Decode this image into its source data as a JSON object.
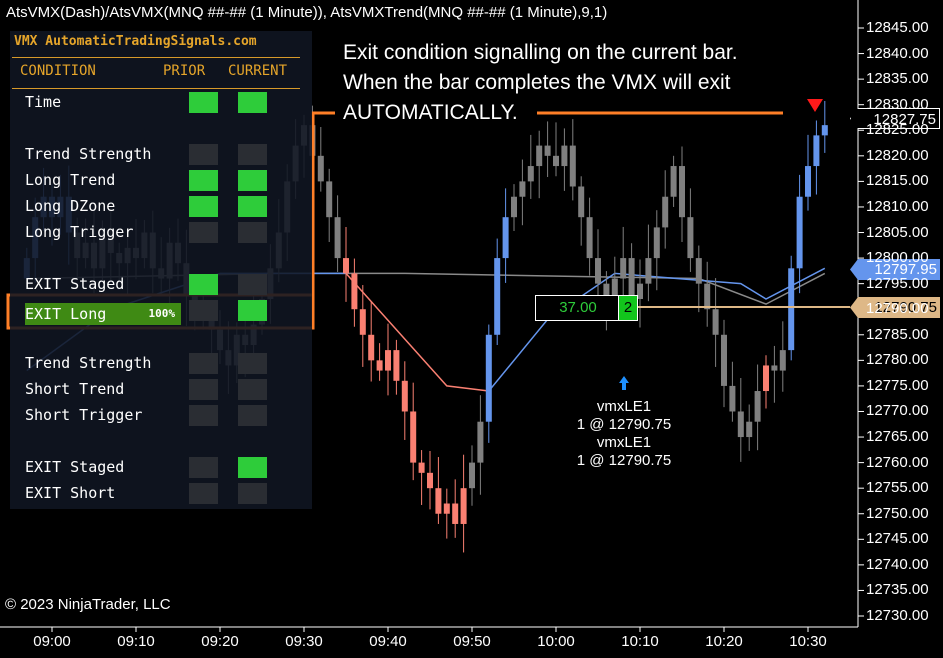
{
  "header": {
    "title": "AtsVMX(Dash)/AtsVMX(MNQ ##-## (1 Minute)), AtsVMXTrend(MNQ ##-## (1 Minute),9,1)"
  },
  "copyright": "© 2023 NinjaTrader, LLC",
  "panel": {
    "title": "VMX AutomaticTradingSignals.com",
    "headers": {
      "condition": "CONDITION",
      "prior": "PRIOR",
      "current": "CURRENT"
    },
    "rows": [
      {
        "label": "Time",
        "prior": "on",
        "current": "on"
      },
      {
        "label": "Trend Strength",
        "prior": "off",
        "current": "off"
      },
      {
        "label": "Long Trend",
        "prior": "on",
        "current": "on"
      },
      {
        "label": "Long DZone",
        "prior": "on",
        "current": "on"
      },
      {
        "label": "Long Trigger",
        "prior": "off",
        "current": "off"
      },
      {
        "label": "EXIT Staged",
        "prior": "on",
        "current": "off"
      },
      {
        "label": "EXIT Long",
        "prior": "off",
        "current": "on",
        "highlight_pct": "100%"
      },
      {
        "label": "Trend Strength",
        "prior": "off",
        "current": "off"
      },
      {
        "label": "Short Trend",
        "prior": "off",
        "current": "off"
      },
      {
        "label": "Short Trigger",
        "prior": "off",
        "current": "off"
      },
      {
        "label": "EXIT Staged",
        "prior": "off",
        "current": "on"
      },
      {
        "label": "EXIT Short",
        "prior": "off",
        "current": "off"
      }
    ]
  },
  "annotation": {
    "line1": "Exit condition signalling on the current bar.",
    "line2": "When the bar completes the VMX will exit",
    "line3": "AUTOMATICALLY."
  },
  "position": {
    "pnl": "37.00",
    "quantity": "2"
  },
  "trades": [
    {
      "name": "vmxLE1",
      "detail": "1 @ 12790.75"
    },
    {
      "name": "vmxLE1",
      "detail": "1 @ 12790.75"
    }
  ],
  "price_tags": {
    "last": "12827.75",
    "trend": "12797.95",
    "entry": "12790.75"
  },
  "colors": {
    "up_trend": "#6495ed",
    "down_trend": "#fa8072",
    "neutral": "#808080",
    "accent": "#ff7f27",
    "entry": "#deb887",
    "signal_on": "#2ecc3a"
  },
  "chart_data": {
    "type": "candlestick",
    "y_ticks": [
      "12845.00",
      "12840.00",
      "12835.00",
      "12830.00",
      "12825.00",
      "12820.00",
      "12815.00",
      "12810.00",
      "12805.00",
      "12800.00",
      "12795.00",
      "12790.00",
      "12785.00",
      "12780.00",
      "12775.00",
      "12770.00",
      "12765.00",
      "12760.00",
      "12755.00",
      "12750.00",
      "12745.00",
      "12740.00",
      "12735.00",
      "12730.00"
    ],
    "ylim": [
      12730,
      12845
    ],
    "x_ticks": [
      "09:00",
      "09:10",
      "09:20",
      "09:30",
      "09:40",
      "09:50",
      "10:00",
      "10:10",
      "10:20",
      "10:30"
    ],
    "start_time": "08:57",
    "first_open": 12796,
    "closes": [
      12800,
      12808,
      12812,
      12808,
      12812,
      12805,
      12800,
      12803,
      12798,
      12804,
      12801,
      12799,
      12802,
      12800,
      12805,
      12798,
      12796,
      12803,
      12799,
      12793,
      12790,
      12788,
      12786,
      12782,
      12779,
      12785,
      12783,
      12787,
      12792,
      12798,
      12805,
      12815,
      12822,
      12826,
      12820,
      12815,
      12808,
      12800,
      12797,
      12790,
      12785,
      12780,
      12778,
      12782,
      12776,
      12770,
      12760,
      12758,
      12755,
      12750,
      12752,
      12748,
      12755,
      12760,
      12768,
      12785,
      12800,
      12808,
      12812,
      12815,
      12818,
      12822,
      12820,
      12818,
      12822,
      12814,
      12808,
      12800,
      12795,
      12790,
      12796,
      12800,
      12792,
      12795,
      12800,
      12806,
      12812,
      12818,
      12808,
      12800,
      12795,
      12790,
      12785,
      12775,
      12770,
      12765,
      12768,
      12774,
      12779,
      12778,
      12782,
      12798,
      12812,
      12818,
      12824,
      12826
    ],
    "bar_colors": "bbbbbbggggggggggggggggggggggggggggggggrrrrrrrrrrrrrrrggbbbggggggggggggggggggggggggggggggrggbbbbb",
    "trend_line": [
      [
        0,
        12796
      ],
      [
        30,
        12797
      ],
      [
        45,
        12797
      ],
      [
        80,
        12796
      ],
      [
        88,
        12791
      ],
      [
        95,
        12797
      ]
    ],
    "signal_line": [
      [
        0,
        12778
      ],
      [
        10,
        12790
      ],
      [
        23,
        12797
      ],
      [
        38,
        12797
      ],
      [
        50,
        12775
      ],
      [
        55,
        12774
      ],
      [
        62,
        12788
      ],
      [
        70,
        12797
      ],
      [
        85,
        12795
      ],
      [
        88,
        12792
      ],
      [
        95,
        12798
      ]
    ]
  }
}
